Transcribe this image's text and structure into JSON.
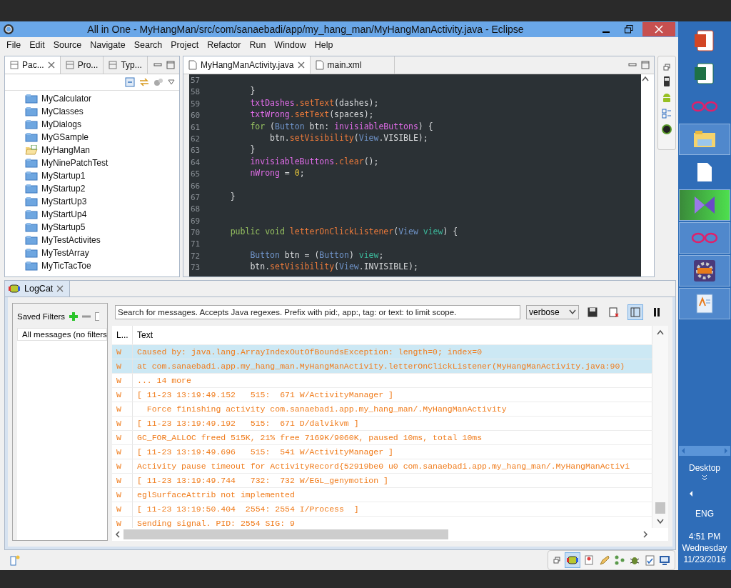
{
  "window": {
    "title": "All in One - MyHangMan/src/com/sanaebadi/app/my_hang_man/MyHangManActivity.java - Eclipse"
  },
  "menu": [
    "File",
    "Edit",
    "Source",
    "Navigate",
    "Search",
    "Project",
    "Refactor",
    "Run",
    "Window",
    "Help"
  ],
  "left_view": {
    "tabs": [
      {
        "label": "Pac...",
        "selected": true
      },
      {
        "label": "Pro...",
        "selected": false
      },
      {
        "label": "Typ...",
        "selected": false
      }
    ],
    "projects": [
      {
        "name": "MyCalculator",
        "open": false
      },
      {
        "name": "MyClasses",
        "open": false
      },
      {
        "name": "MyDialogs",
        "open": false
      },
      {
        "name": "MyGSample",
        "open": false
      },
      {
        "name": "MyHangMan",
        "open": true
      },
      {
        "name": "MyNinePatchTest",
        "open": false
      },
      {
        "name": "MyStartup1",
        "open": false
      },
      {
        "name": "MyStartup2",
        "open": false
      },
      {
        "name": "MyStartUp3",
        "open": false
      },
      {
        "name": "MyStartUp4",
        "open": false
      },
      {
        "name": "MyStartup5",
        "open": false
      },
      {
        "name": "MyTestActivites",
        "open": false
      },
      {
        "name": "MyTestArray",
        "open": false
      },
      {
        "name": "MyTicTacToe",
        "open": false
      }
    ]
  },
  "editor": {
    "tabs": [
      {
        "label": "MyHangManActivity.java",
        "selected": true
      },
      {
        "label": "main.xml",
        "selected": false
      }
    ],
    "lines": [
      {
        "num": "57"
      },
      {
        "num": "58",
        "tokens": [
          {
            "kind": "plain",
            "text": "        }"
          }
        ]
      },
      {
        "num": "59",
        "tokens": [
          {
            "kind": "field",
            "text": "        txtDashes"
          },
          {
            "kind": "method",
            "text": ".setText"
          },
          {
            "kind": "plain",
            "text": "(dashes);"
          }
        ]
      },
      {
        "num": "60",
        "tokens": [
          {
            "kind": "field",
            "text": "        txtWrong"
          },
          {
            "kind": "method",
            "text": ".setText"
          },
          {
            "kind": "plain",
            "text": "(spaces);"
          }
        ]
      },
      {
        "num": "61",
        "tokens": [
          {
            "kind": "keyword",
            "text": "        for"
          },
          {
            "kind": "plain",
            "text": " ("
          },
          {
            "kind": "type",
            "text": "Button"
          },
          {
            "kind": "plain",
            "text": " btn: "
          },
          {
            "kind": "field",
            "text": "invisiableButtons"
          },
          {
            "kind": "plain",
            "text": ") {"
          }
        ]
      },
      {
        "num": "62",
        "tokens": [
          {
            "kind": "plain",
            "text": "            btn."
          },
          {
            "kind": "method",
            "text": "setVisibility"
          },
          {
            "kind": "plain",
            "text": "("
          },
          {
            "kind": "type",
            "text": "View"
          },
          {
            "kind": "plain",
            "text": ".VISIBLE);"
          }
        ]
      },
      {
        "num": "63",
        "tokens": [
          {
            "kind": "plain",
            "text": "        }"
          }
        ]
      },
      {
        "num": "64",
        "tokens": [
          {
            "kind": "field",
            "text": "        invisiableButtons"
          },
          {
            "kind": "method",
            "text": ".clear"
          },
          {
            "kind": "plain",
            "text": "();"
          }
        ]
      },
      {
        "num": "65",
        "tokens": [
          {
            "kind": "field",
            "text": "        nWrong"
          },
          {
            "kind": "plain",
            "text": " = "
          },
          {
            "kind": "number",
            "text": "0"
          },
          {
            "kind": "plain",
            "text": ";"
          }
        ]
      },
      {
        "num": "66"
      },
      {
        "num": "67",
        "tokens": [
          {
            "kind": "plain",
            "text": "    }"
          }
        ]
      },
      {
        "num": "68"
      },
      {
        "num": "69"
      },
      {
        "num": "70",
        "tokens": [
          {
            "kind": "keyword",
            "text": "    public void "
          },
          {
            "kind": "method",
            "text": "letterOnClickListener"
          },
          {
            "kind": "plain",
            "text": "("
          },
          {
            "kind": "type",
            "text": "View "
          },
          {
            "kind": "local",
            "text": "view"
          },
          {
            "kind": "plain",
            "text": ") {"
          }
        ]
      },
      {
        "num": "71"
      },
      {
        "num": "72",
        "tokens": [
          {
            "kind": "type",
            "text": "        Button"
          },
          {
            "kind": "plain",
            "text": " btn = ("
          },
          {
            "kind": "type",
            "text": "Button"
          },
          {
            "kind": "plain",
            "text": ") "
          },
          {
            "kind": "local",
            "text": "view"
          },
          {
            "kind": "plain",
            "text": ";"
          }
        ]
      },
      {
        "num": "73",
        "tokens": [
          {
            "kind": "plain",
            "text": "        btn."
          },
          {
            "kind": "method",
            "text": "setVisibility"
          },
          {
            "kind": "plain",
            "text": "("
          },
          {
            "kind": "type",
            "text": "View"
          },
          {
            "kind": "plain",
            "text": ".INVISIBLE);"
          }
        ]
      }
    ]
  },
  "logcat": {
    "tab": "LogCat",
    "saved_filters": {
      "title": "Saved Filters",
      "items": [
        {
          "label": "All messages (no filters",
          "selected": false
        }
      ]
    },
    "search": {
      "placeholder": "Search for messages. Accepts Java regexes. Prefix with pid:, app:, tag: or text: to limit scope."
    },
    "level_select": "verbose",
    "columns": [
      "L...",
      "Text"
    ],
    "rows": [
      {
        "level": "W",
        "text": "Caused by: java.lang.ArrayIndexOutOfBoundsException: length=0; index=0",
        "selected": true
      },
      {
        "level": "W",
        "text": "at com.sanaebadi.app.my_hang_man.MyHangManActivity.letterOnClickListener(MyHangManActivity.java:90)",
        "selected": true
      },
      {
        "level": "W",
        "text": "... 14 more",
        "selected": false
      },
      {
        "level": "W",
        "text": "[ 11-23 13:19:49.152   515:  671 W/ActivityManager ]",
        "selected": false
      },
      {
        "level": "W",
        "text": "  Force finishing activity com.sanaebadi.app.my_hang_man/.MyHangManActivity",
        "selected": false
      },
      {
        "level": "W",
        "text": "[ 11-23 13:19:49.192   515:  671 D/dalvikvm ]",
        "selected": false
      },
      {
        "level": "W",
        "text": "GC_FOR_ALLOC freed 515K, 21% free 7169K/9060K, paused 10ms, total 10ms",
        "selected": false
      },
      {
        "level": "W",
        "text": "[ 11-23 13:19:49.696   515:  541 W/ActivityManager ]",
        "selected": false
      },
      {
        "level": "W",
        "text": "Activity pause timeout for ActivityRecord{52919be0 u0 com.sanaebadi.app.my_hang_man/.MyHangManActivi",
        "selected": false
      },
      {
        "level": "W",
        "text": "[ 11-23 13:19:49.744   732:  732 W/EGL_genymotion ]",
        "selected": false
      },
      {
        "level": "W",
        "text": "eglSurfaceAttrib not implemented",
        "selected": false
      },
      {
        "level": "W",
        "text": "[ 11-23 13:19:50.404  2554: 2554 I/Process  ]",
        "selected": false
      },
      {
        "level": "W",
        "text": "Sending signal. PID: 2554 SIG: 9",
        "selected": false
      }
    ]
  },
  "taskbar": {
    "desktop_label": "Desktop",
    "language": "ENG",
    "time": "4:51 PM",
    "day": "Wednesday",
    "date": "11/23/2016"
  }
}
